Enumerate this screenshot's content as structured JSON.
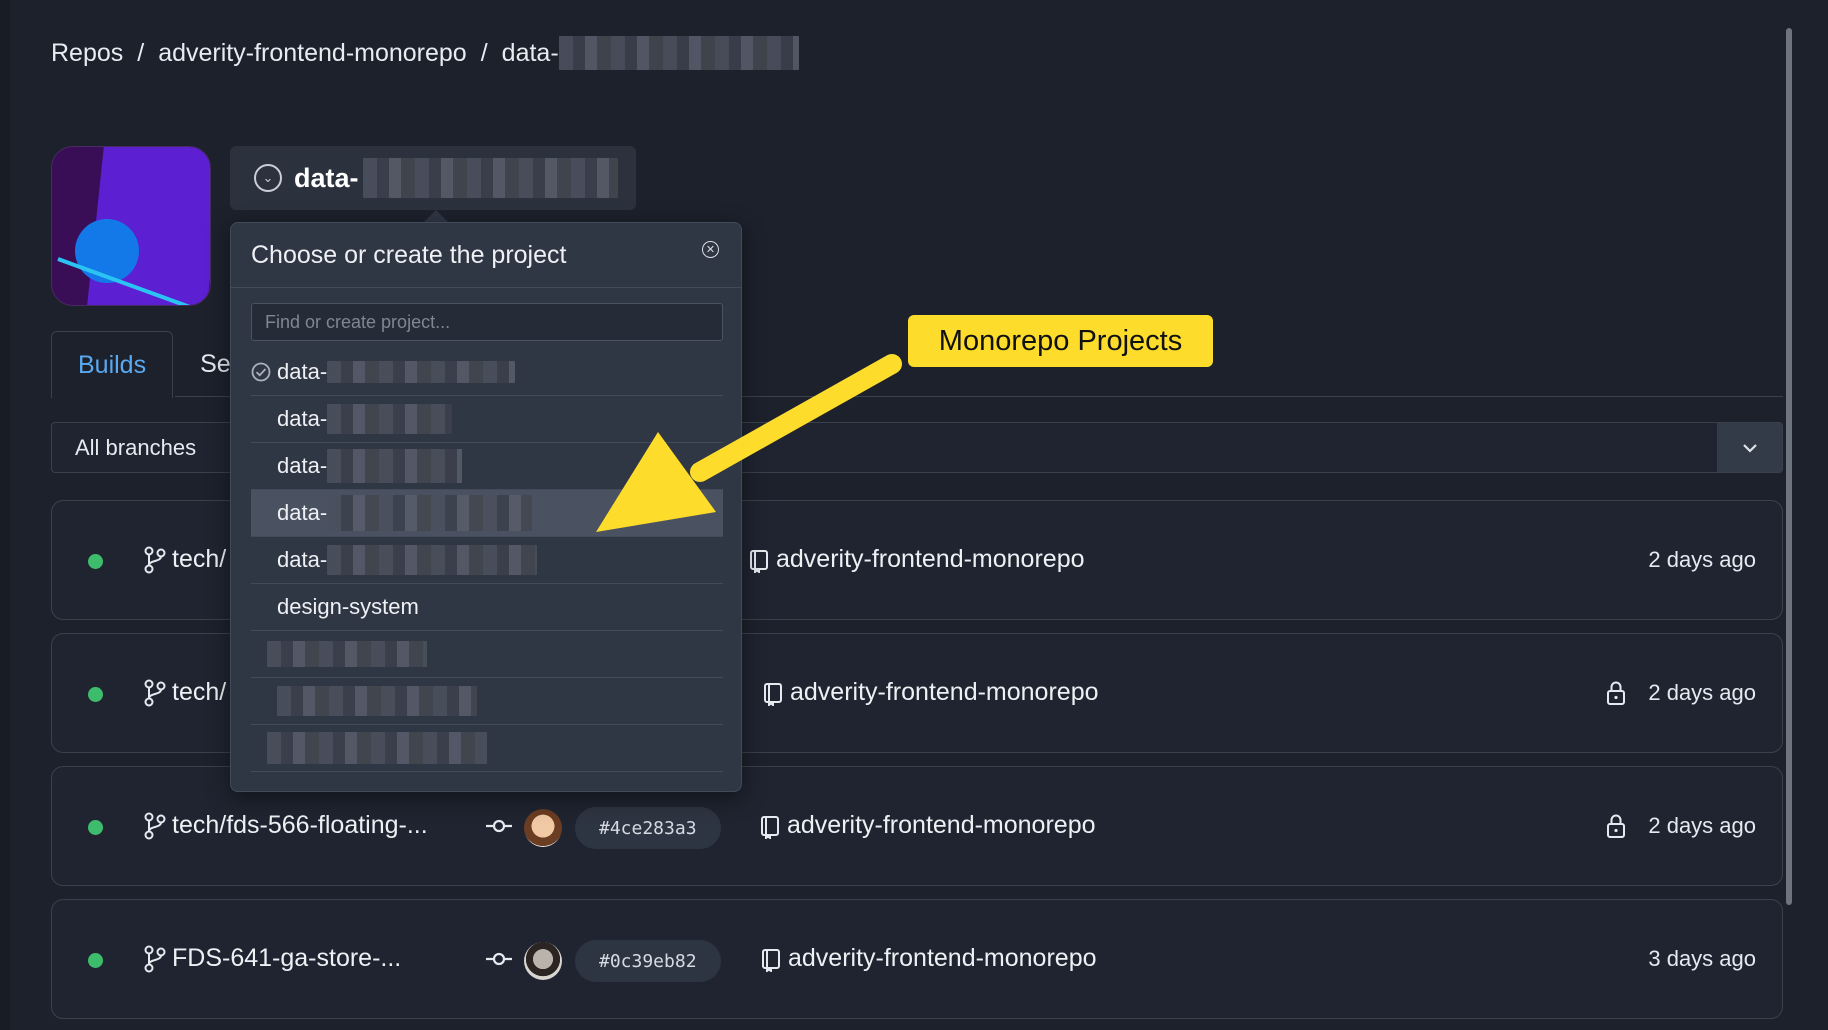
{
  "breadcrumb": {
    "root": "Repos",
    "repo": "adverity-frontend-monorepo",
    "project_prefix": "data-"
  },
  "project": {
    "name_prefix": "data-"
  },
  "tabs": {
    "builds": "Builds",
    "second_partial": "Se"
  },
  "filter": {
    "branches_label": "All branches"
  },
  "dropdown": {
    "title": "Choose or create the project",
    "search_placeholder": "Find or create project...",
    "items": [
      {
        "label": "data-",
        "selected": true
      },
      {
        "label": "data-"
      },
      {
        "label": "data-"
      },
      {
        "label": "data-",
        "highlighted": true
      },
      {
        "label": "data-"
      },
      {
        "label": "design-system"
      },
      {
        "label": ""
      },
      {
        "label": ""
      },
      {
        "label": ""
      }
    ]
  },
  "annotation": {
    "label": "Monorepo Projects"
  },
  "builds": [
    {
      "branch": "tech/",
      "repo": "adverity-frontend-monorepo",
      "time": "2 days ago",
      "locked": false,
      "status_color": "#3dbd6c"
    },
    {
      "branch": "tech/",
      "repo": "adverity-frontend-monorepo",
      "time": "2 days ago",
      "locked": true,
      "status_color": "#3dbd6c"
    },
    {
      "branch": "tech/fds-566-floating-...",
      "sha": "#4ce283a3",
      "repo": "adverity-frontend-monorepo",
      "time": "2 days ago",
      "locked": true,
      "status_color": "#3dbd6c"
    },
    {
      "branch": "FDS-641-ga-store-...",
      "sha": "#0c39eb82",
      "repo": "adverity-frontend-monorepo",
      "time": "3 days ago",
      "locked": false,
      "status_color": "#3dbd6c"
    }
  ],
  "colors": {
    "background": "#1c212c",
    "accent_tab": "#5aa9f0",
    "status_success": "#3dbd6c",
    "callout": "#fddc2b"
  }
}
